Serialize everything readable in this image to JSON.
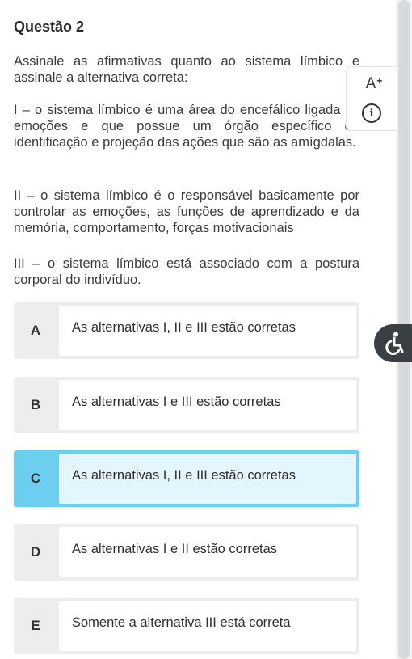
{
  "question": {
    "title": "Questão 2",
    "intro": "Assinale as afirmativas quanto ao sistema límbico e assinale a alternativa correta:",
    "statements": [
      "I – o sistema límbico é uma área do encefálico ligada as emoções e que possue um órgão específico de identificação e projeção das ações que são as amígdalas.",
      "II – o sistema límbico é o responsável basicamente por controlar as emoções, as funções de aprendizado e da memória, comportamento, forças motivacionais",
      "III – o sistema límbico está associado com a postura corporal do indivíduo."
    ]
  },
  "options": [
    {
      "letter": "A",
      "text": "As alternativas I, II e III estão corretas",
      "selected": false
    },
    {
      "letter": "B",
      "text": "As alternativas I e III estão corretas",
      "selected": false
    },
    {
      "letter": "C",
      "text": "As alternativas I, II e III estão corretas",
      "selected": true
    },
    {
      "letter": "D",
      "text": "As alternativas I e II estão corretas",
      "selected": false
    },
    {
      "letter": "E",
      "text": "Somente a alternativa III está correta",
      "selected": false
    }
  ],
  "toolbar": {
    "font_size_label": "A",
    "font_size_sup": "+",
    "info_label": "i"
  },
  "icons": {
    "font_size": "font-size-increase-icon",
    "info": "info-icon",
    "accessibility": "accessibility-icon"
  },
  "colors": {
    "selected_border": "#6ccfef",
    "selected_fill": "#e4f6fd",
    "option_border": "#ededed"
  }
}
